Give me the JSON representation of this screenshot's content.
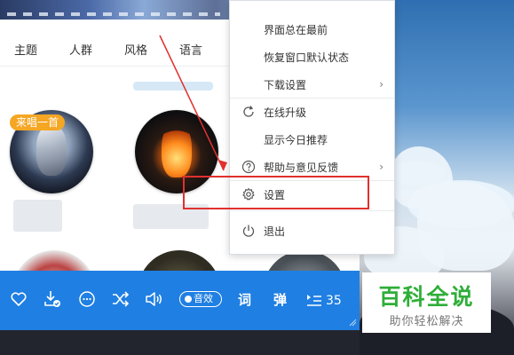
{
  "app": {
    "tabs": [
      "主题",
      "人群",
      "风格",
      "语言"
    ],
    "sing_badge": "来唱一首"
  },
  "player": {
    "sound_effect_label": "音效",
    "lyrics_label": "词",
    "danmaku_label": "弹",
    "playlist_count": "35",
    "icons": [
      "heart-icon",
      "download-icon",
      "more-icon",
      "shuffle-icon",
      "volume-icon",
      "playlist-icon"
    ],
    "accent": "#1f7fe3"
  },
  "menu": {
    "items": [
      {
        "label": "界面总在最前",
        "icon": "",
        "submenu": false
      },
      {
        "label": "恢复窗口默认状态",
        "icon": "",
        "submenu": false
      },
      {
        "label": "下载设置",
        "icon": "",
        "submenu": true
      },
      {
        "label": "在线升级",
        "icon": "refresh-icon",
        "submenu": false
      },
      {
        "label": "显示今日推荐",
        "icon": "",
        "submenu": false
      },
      {
        "label": "帮助与意见反馈",
        "icon": "help-icon",
        "submenu": true
      },
      {
        "label": "设置",
        "icon": "gear-icon",
        "submenu": false
      },
      {
        "label": "退出",
        "icon": "power-icon",
        "submenu": false
      }
    ],
    "highlight_color": "#e0312f"
  },
  "watermark": {
    "title": "百科全说",
    "subtitle": "助你轻松解决",
    "color": "#2fae39"
  }
}
